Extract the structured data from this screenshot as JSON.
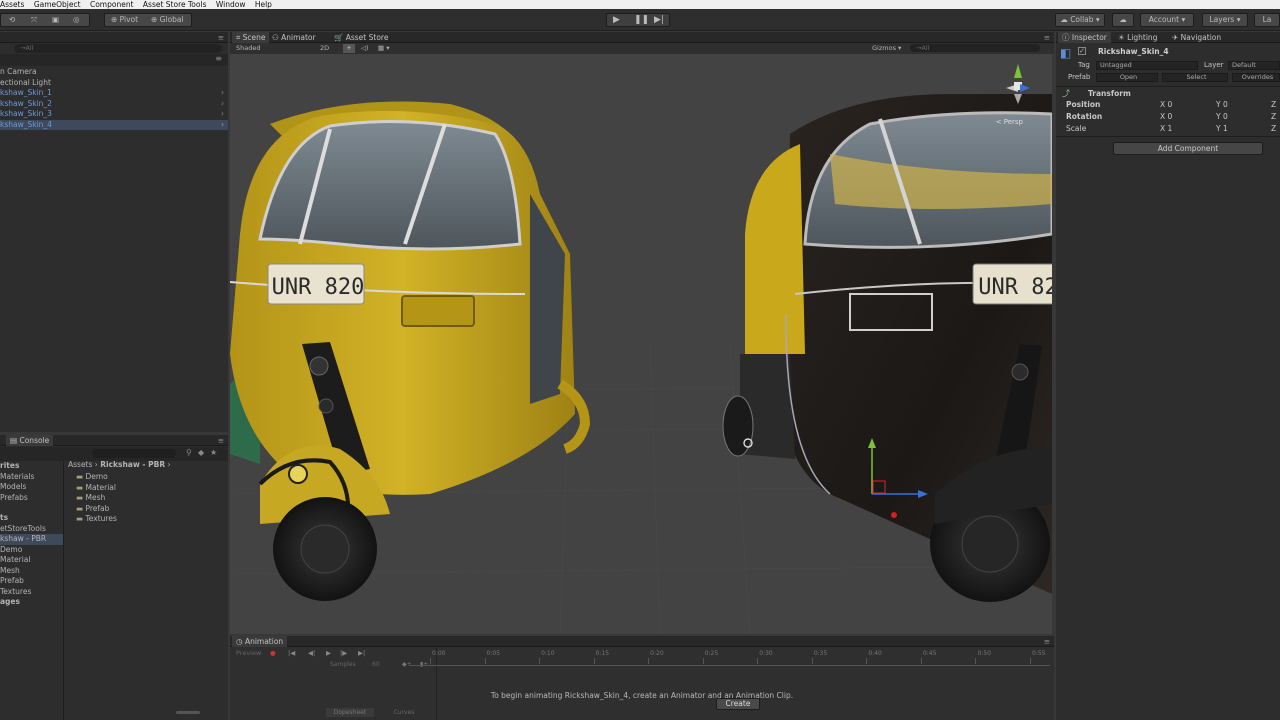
{
  "menu": [
    "Assets",
    "GameObject",
    "Component",
    "Asset Store Tools",
    "Window",
    "Help"
  ],
  "toolbar": {
    "pivot": "Pivot",
    "global": "Global",
    "collab": "Collab",
    "account": "Account",
    "layers": "Layers",
    "layout": "La"
  },
  "hierarchy": {
    "search_placeholder": "→All",
    "items": [
      {
        "label": "n Camera",
        "type": "normal"
      },
      {
        "label": "ectional Light",
        "type": "normal"
      },
      {
        "label": "kshaw_Skin_1",
        "type": "prefab"
      },
      {
        "label": "kshaw_Skin_2",
        "type": "prefab"
      },
      {
        "label": "kshaw_Skin_3",
        "type": "prefab"
      },
      {
        "label": "kshaw_Skin_4",
        "type": "selected"
      }
    ]
  },
  "scene_tabs": [
    {
      "label": "Scene",
      "active": true
    },
    {
      "label": "Animator",
      "active": false
    },
    {
      "label": "Asset Store",
      "active": false
    }
  ],
  "scene_toolbar": {
    "shading": "Shaded",
    "mode": "2D",
    "gizmos": "Gizmos",
    "search": "→All",
    "persp": "< Persp"
  },
  "plates": {
    "left": "UNR 820",
    "right": "UNR 82"
  },
  "console_tab": "Console",
  "project": {
    "favorites": [
      "rites",
      "Materials",
      "Models",
      "Prefabs"
    ],
    "assets_header": "ts",
    "tree": [
      "etStoreTools",
      "kshaw - PBR",
      "Demo",
      "Material",
      "Mesh",
      "Prefab",
      "Textures",
      "ages"
    ],
    "breadcrumb": [
      "Assets",
      "Rickshaw - PBR"
    ],
    "folders": [
      "Demo",
      "Material",
      "Mesh",
      "Prefab",
      "Textures"
    ]
  },
  "animation": {
    "tab": "Animation",
    "preview": "Preview",
    "samples_label": "Samples",
    "samples_value": "60",
    "ticks": [
      "0:00",
      "0:05",
      "0:10",
      "0:15",
      "0:20",
      "0:25",
      "0:30",
      "0:35",
      "0:40",
      "0:45",
      "0:50",
      "0:55"
    ],
    "message": "To begin animating Rickshaw_Skin_4, create an Animator and an Animation Clip.",
    "create": "Create",
    "dopesheet": "Dopesheet",
    "curves": "Curves"
  },
  "inspector": {
    "tabs": [
      {
        "label": "Inspector",
        "active": true
      },
      {
        "label": "Lighting",
        "active": false
      },
      {
        "label": "Navigation",
        "active": false
      }
    ],
    "object_name": "Rickshaw_Skin_4",
    "tag_label": "Tag",
    "tag_value": "Untagged",
    "layer_label": "Layer",
    "layer_value": "Default",
    "prefab_label": "Prefab",
    "open": "Open",
    "select": "Select",
    "overrides": "Overrides",
    "transform": "Transform",
    "rows": [
      {
        "label": "Position",
        "x": "0",
        "y": "0"
      },
      {
        "label": "Rotation",
        "x": "0",
        "y": "0"
      },
      {
        "label": "Scale",
        "x": "1",
        "y": "1"
      }
    ],
    "add_component": "Add Component"
  },
  "colors": {
    "accent_blue": "#6c9bdc",
    "yellow_body": "#c9a81c",
    "black_body": "#1f1c1a"
  }
}
